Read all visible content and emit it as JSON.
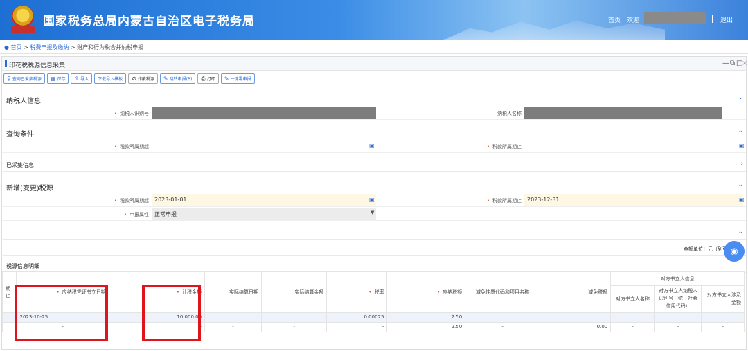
{
  "header": {
    "title": "国家税务总局内蒙古自治区电子税务局",
    "home": "首页",
    "welcome": "欢迎",
    "logout": "退出"
  },
  "breadcrumb": {
    "home": "首页",
    "sep1": ">",
    "level2": "税费申报及缴纳",
    "sep2": ">",
    "level3": "财产和行为税合并纳税申报"
  },
  "panel": {
    "title": "印花税税源信息采集"
  },
  "toolbar": {
    "query_collected": "查询已采集税源",
    "save": "保存",
    "import": "导入",
    "download_template": "下载导入模板",
    "void_source": "作废税源",
    "jump_declare": "跳转申报(B)",
    "print": "打印",
    "zero_declare": "一键零申报"
  },
  "sections": {
    "taxpayer_info": "纳税人信息",
    "query_conditions": "查询条件",
    "collected_info": "已采集信息",
    "new_source": "新增(变更)税源",
    "detail": "税源信息明细"
  },
  "taxpayer": {
    "id_label": "纳税人识别号",
    "name_label": "纳税人名称"
  },
  "query": {
    "period_start_label": "税款所属期起",
    "period_end_label": "税款所属期止"
  },
  "new_source": {
    "period_start_label": "税款所属期起",
    "period_start_value": "2023-01-01",
    "period_end_label": "税款所属期止",
    "period_end_value": "2023-12-31",
    "declare_attr_label": "申报属性",
    "declare_attr_value": "正常申报"
  },
  "unit_text": "金额单位：元（列至",
  "table": {
    "col_period_end": "期止",
    "col_voucher_date": "应纳税凭证书立日期",
    "col_amount": "计税金额",
    "col_actual_date": "实际结算日期",
    "col_actual_amount": "实际结算金额",
    "col_rate": "税率",
    "col_tax_payable": "应纳税额",
    "col_reduction_code": "减免性质代码和项目名称",
    "col_reduction_amount": "减免税额",
    "col_counterparty_group": "对方书立人信息",
    "col_cp_name": "对方书立人名称",
    "col_cp_id": "对方书立人纳税人识别号（统一社会信用代码）",
    "col_cp_amount": "对方书立人涉及金额",
    "row1": {
      "voucher_date": "2023-10-25",
      "amount": "10,000.00",
      "rate": "0.00025",
      "tax_payable": "2.50"
    },
    "row2": {
      "dash": "-",
      "tax_payable": "2.50",
      "reduction_amount": "0.00"
    }
  }
}
